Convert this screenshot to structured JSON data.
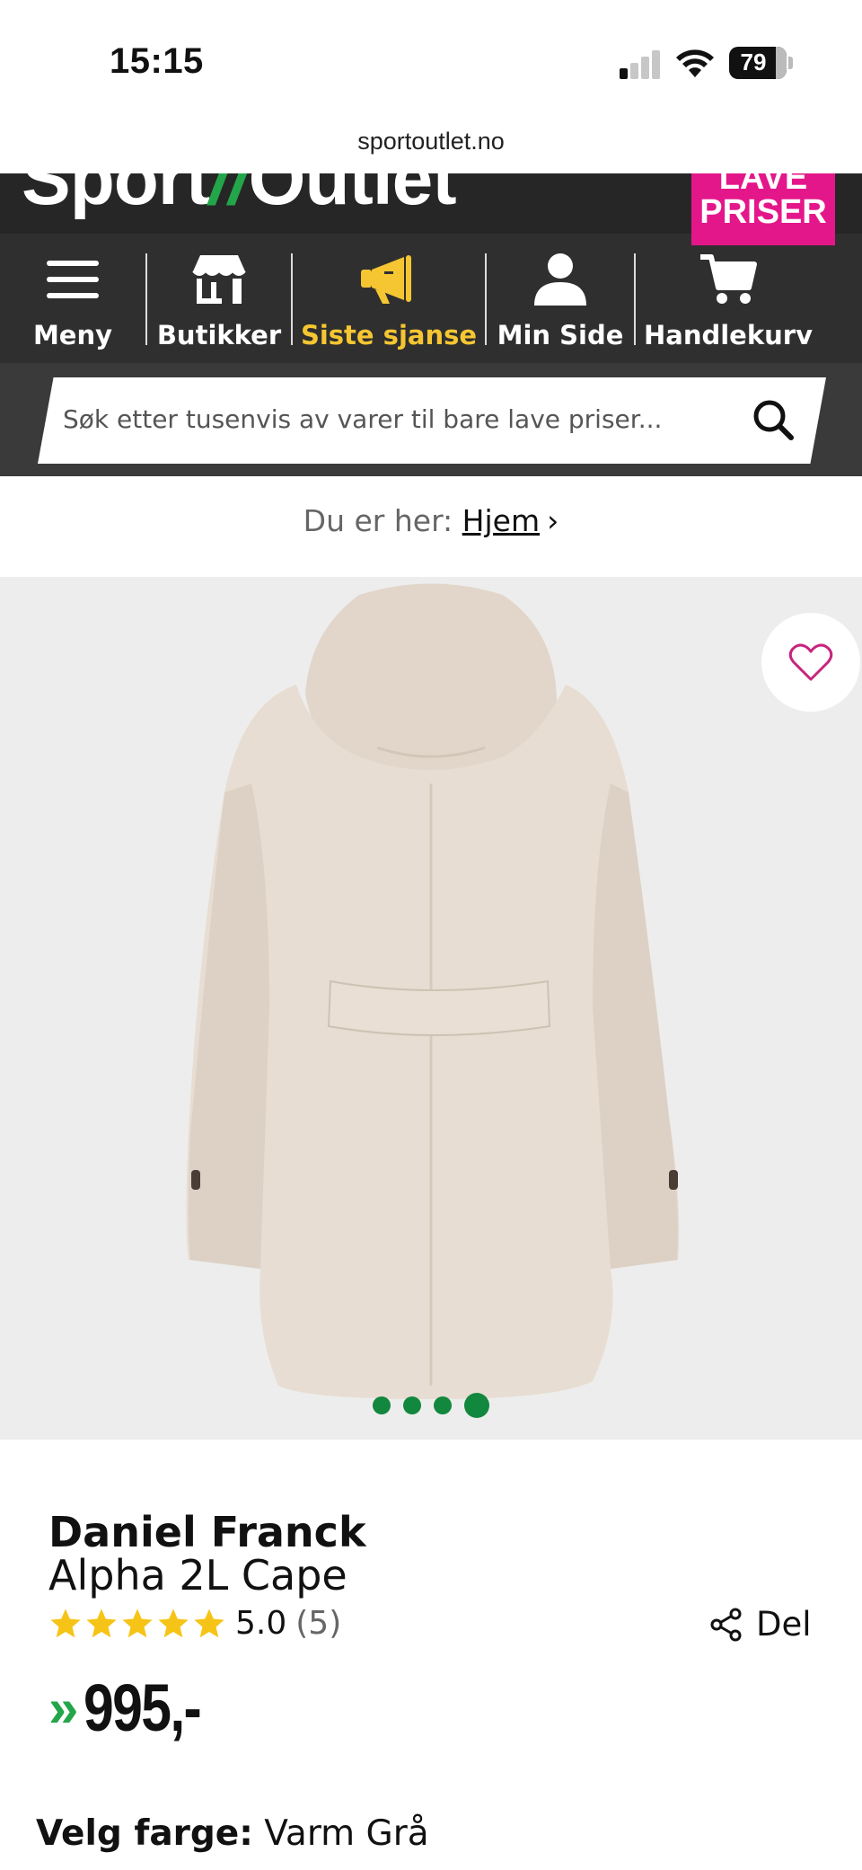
{
  "status_bar": {
    "time": "15:15",
    "battery": "79"
  },
  "browser": {
    "url": "sportoutlet.no"
  },
  "header": {
    "logo_word1": "Sport",
    "logo_slash": "//",
    "logo_word2": "Outlet",
    "badge_line1": "LAVE",
    "badge_line2": "PRISER",
    "badge_color": "#e4178a"
  },
  "nav": {
    "items": [
      {
        "label": "Meny",
        "icon": "menu-icon"
      },
      {
        "label": "Butikker",
        "icon": "store-icon"
      },
      {
        "label": "Siste sjanse",
        "icon": "megaphone-icon"
      },
      {
        "label": "Min Side",
        "icon": "user-icon"
      },
      {
        "label": "Handlekurv",
        "icon": "cart-icon"
      }
    ],
    "highlight_color": "#f5c632"
  },
  "search": {
    "placeholder": "Søk etter tusenvis av varer til bare lave priser..."
  },
  "breadcrumb": {
    "prefix": "Du er her:",
    "home": "Hjem",
    "chevron": "›"
  },
  "gallery": {
    "image_count": 4,
    "active_index": 3
  },
  "product": {
    "brand": "Daniel Franck",
    "name": "Alpha 2L Cape",
    "rating_value": "5.0",
    "rating_count": "(5)",
    "stars": 5,
    "share_label": "Del",
    "price_arrows": "»",
    "price": "995,-",
    "color_label": "Velg farge:",
    "color_value": "Varm Grå"
  }
}
